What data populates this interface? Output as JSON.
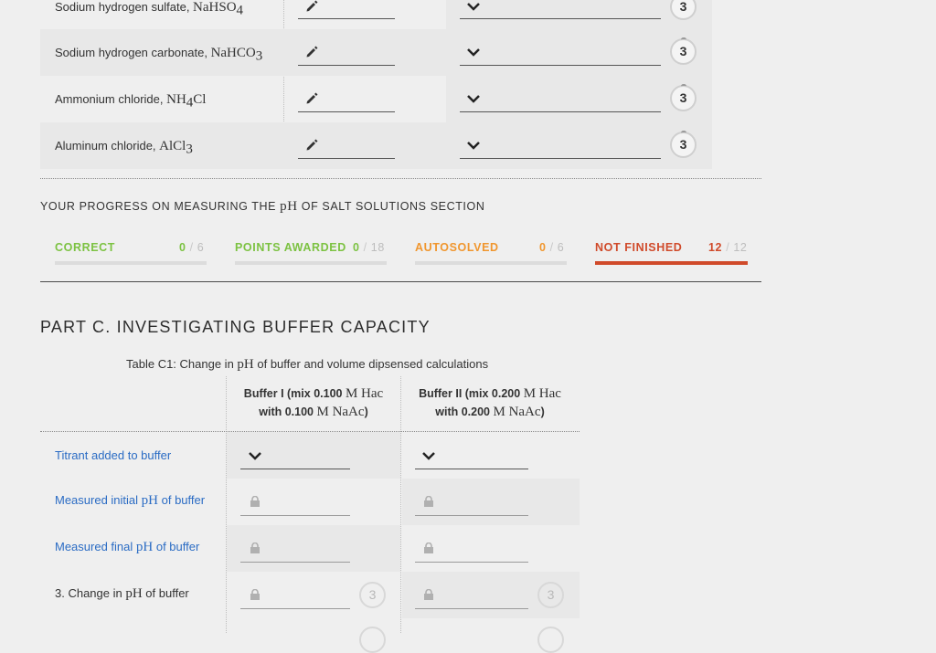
{
  "salts": [
    {
      "name": "Sodium hydrogen sulfate, ",
      "formula": "NaHSO",
      "sub": "4",
      "points": "3"
    },
    {
      "name": "Sodium hydrogen carbonate, ",
      "formula": "NaHCO",
      "sub": "3",
      "points": "3"
    },
    {
      "name": "Ammonium chloride, ",
      "formula": "NH",
      "sub": "4",
      "formula_tail": "Cl",
      "points": "3"
    },
    {
      "name": "Aluminum chloride, ",
      "formula": "AlCl",
      "sub": "3",
      "points": "3"
    }
  ],
  "progress": {
    "title_pre": "YOUR PROGRESS ON MEASURING THE ",
    "title_math": "pH",
    "title_post": " OF SALT SOLUTIONS SECTION",
    "stats": [
      {
        "label": "CORRECT",
        "value": "0",
        "total": "6",
        "color": "#7cc242",
        "fraction": 0
      },
      {
        "label": "POINTS AWARDED",
        "value": "0",
        "total": "18",
        "color": "#7cc242",
        "fraction": 0
      },
      {
        "label": "AUTOSOLVED",
        "value": "0",
        "total": "6",
        "color": "#f0962e",
        "fraction": 0
      },
      {
        "label": "NOT FINISHED",
        "value": "12",
        "total": "12",
        "color": "#d04a2a",
        "fraction": 1
      }
    ],
    "sep": "/"
  },
  "partC": {
    "title": "PART C. INVESTIGATING BUFFER CAPACITY",
    "caption_pre": "Table C1: Change in ",
    "caption_math": "pH",
    "caption_post": " of buffer and volume dipsensed calculations",
    "col1": {
      "l1a": "Buffer I (mix 0.100 ",
      "l1m": "M Hac",
      "l2a": "with 0.100 ",
      "l2m": "M NaAc",
      ")": ")"
    },
    "col2": {
      "l1a": "Buffer II (mix 0.200 ",
      "l1m": "M Hac",
      "l2a": "with 0.200 ",
      "l2m": "M NaAc"
    },
    "rows": [
      {
        "pre": "Titrant added to buffer",
        "math": "",
        "post": ""
      },
      {
        "pre": "Measured initial ",
        "math": "pH",
        "post": " of buffer"
      },
      {
        "pre": "Measured final ",
        "math": "pH",
        "post": " of buffer"
      },
      {
        "pre": "3. Change in ",
        "math": "pH",
        "post": " of buffer"
      }
    ],
    "row_points": "3"
  }
}
